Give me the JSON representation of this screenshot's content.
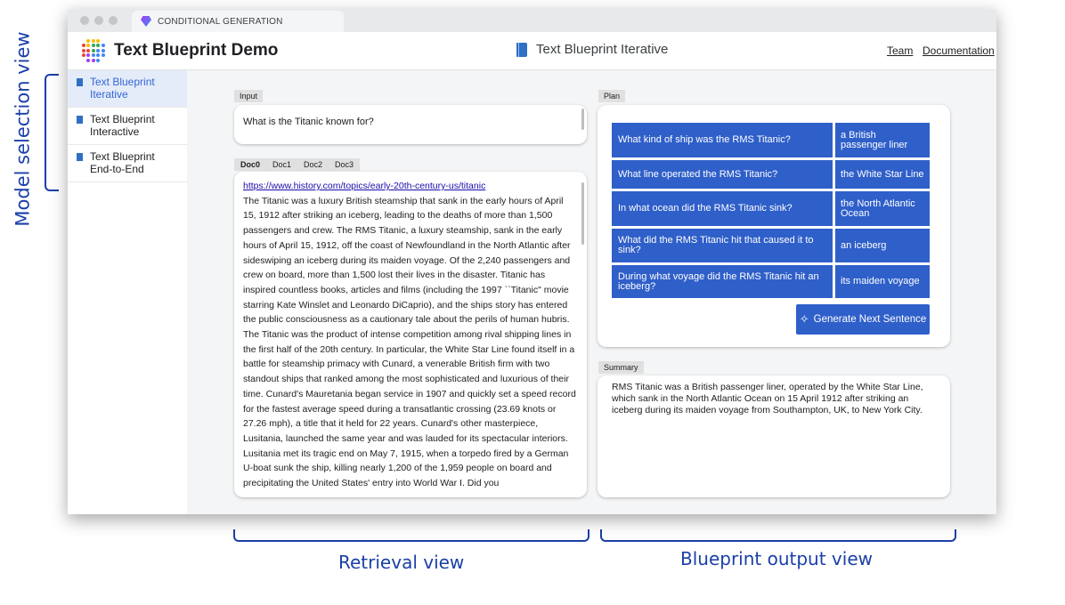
{
  "annotations": {
    "model_selection": "Model selection view",
    "retrieval": "Retrieval view",
    "blueprint_output": "Blueprint output view"
  },
  "browser": {
    "tab_title": "CONDITIONAL GENERATION",
    "tab_icon": "gem-icon"
  },
  "header": {
    "app_title": "Text Blueprint Demo",
    "page_title": "Text Blueprint Iterative",
    "links": [
      "Team",
      "Documentation"
    ]
  },
  "sidebar": {
    "items": [
      {
        "label": "Text Blueprint Iterative",
        "active": true
      },
      {
        "label": "Text Blueprint Interactive",
        "active": false
      },
      {
        "label": "Text Blueprint End-to-End",
        "active": false
      }
    ]
  },
  "input": {
    "label": "Input",
    "value": "What is the Titanic known for?"
  },
  "docs": {
    "tabs": [
      "Doc0",
      "Doc1",
      "Doc2",
      "Doc3"
    ],
    "active": "Doc0",
    "url": "https://www.history.com/topics/early-20th-century-us/titanic",
    "text": "The Titanic was a luxury British steamship that sank in the early hours of April 15, 1912 after striking an iceberg, leading to the deaths of more than 1,500 passengers and crew. The RMS Titanic, a luxury steamship, sank in the early hours of April 15, 1912, off the coast of Newfoundland in the North Atlantic after sideswiping an iceberg during its maiden voyage. Of the 2,240 passengers and crew on board, more than 1,500 lost their lives in the disaster. Titanic has inspired countless books, articles and films (including the 1997 ``Titanic\" movie starring Kate Winslet and Leonardo DiCaprio), and the ships story has entered the public consciousness as a cautionary tale about the perils of human hubris. The Titanic was the product of intense competition among rival shipping lines in the first half of the 20th century. In particular, the White Star Line found itself in a battle for steamship primacy with Cunard, a venerable British firm with two standout ships that ranked among the most sophisticated and luxurious of their time. Cunard's Mauretania began service in 1907 and quickly set a speed record for the fastest average speed during a transatlantic crossing (23.69 knots or 27.26 mph), a title that it held for 22 years. Cunard's other masterpiece, Lusitania, launched the same year and was lauded for its spectacular interiors. Lusitania met its tragic end on May 7, 1915, when a torpedo fired by a German U-boat sunk the ship, killing nearly 1,200 of the 1,959 people on board and precipitating the United States' entry into World War I. Did you"
  },
  "plan": {
    "label": "Plan",
    "rows": [
      {
        "q": "What kind of ship was the RMS Titanic?",
        "a": "a British passenger liner"
      },
      {
        "q": "What line operated the RMS Titanic?",
        "a": "the White Star Line"
      },
      {
        "q": "In what ocean did the RMS Titanic sink?",
        "a": "the North Atlantic Ocean"
      },
      {
        "q": "What did the RMS Titanic hit that caused it to sink?",
        "a": "an iceberg"
      },
      {
        "q": "During what voyage did the RMS Titanic hit an iceberg?",
        "a": "its maiden voyage"
      }
    ],
    "generate_label": "Generate Next Sentence",
    "generate_icon": "sparkle-icon"
  },
  "summary": {
    "label": "Summary",
    "text": "RMS Titanic was a British passenger liner, operated by the White Star Line, which sank in the North Atlantic Ocean on 15 April 1912 after striking an iceberg during its maiden voyage from Southampton, UK, to New York City."
  },
  "colors": {
    "accent": "#2f5fc9",
    "annotation": "#1a3fa8",
    "sidebar_active_bg": "#e4ebf9"
  }
}
